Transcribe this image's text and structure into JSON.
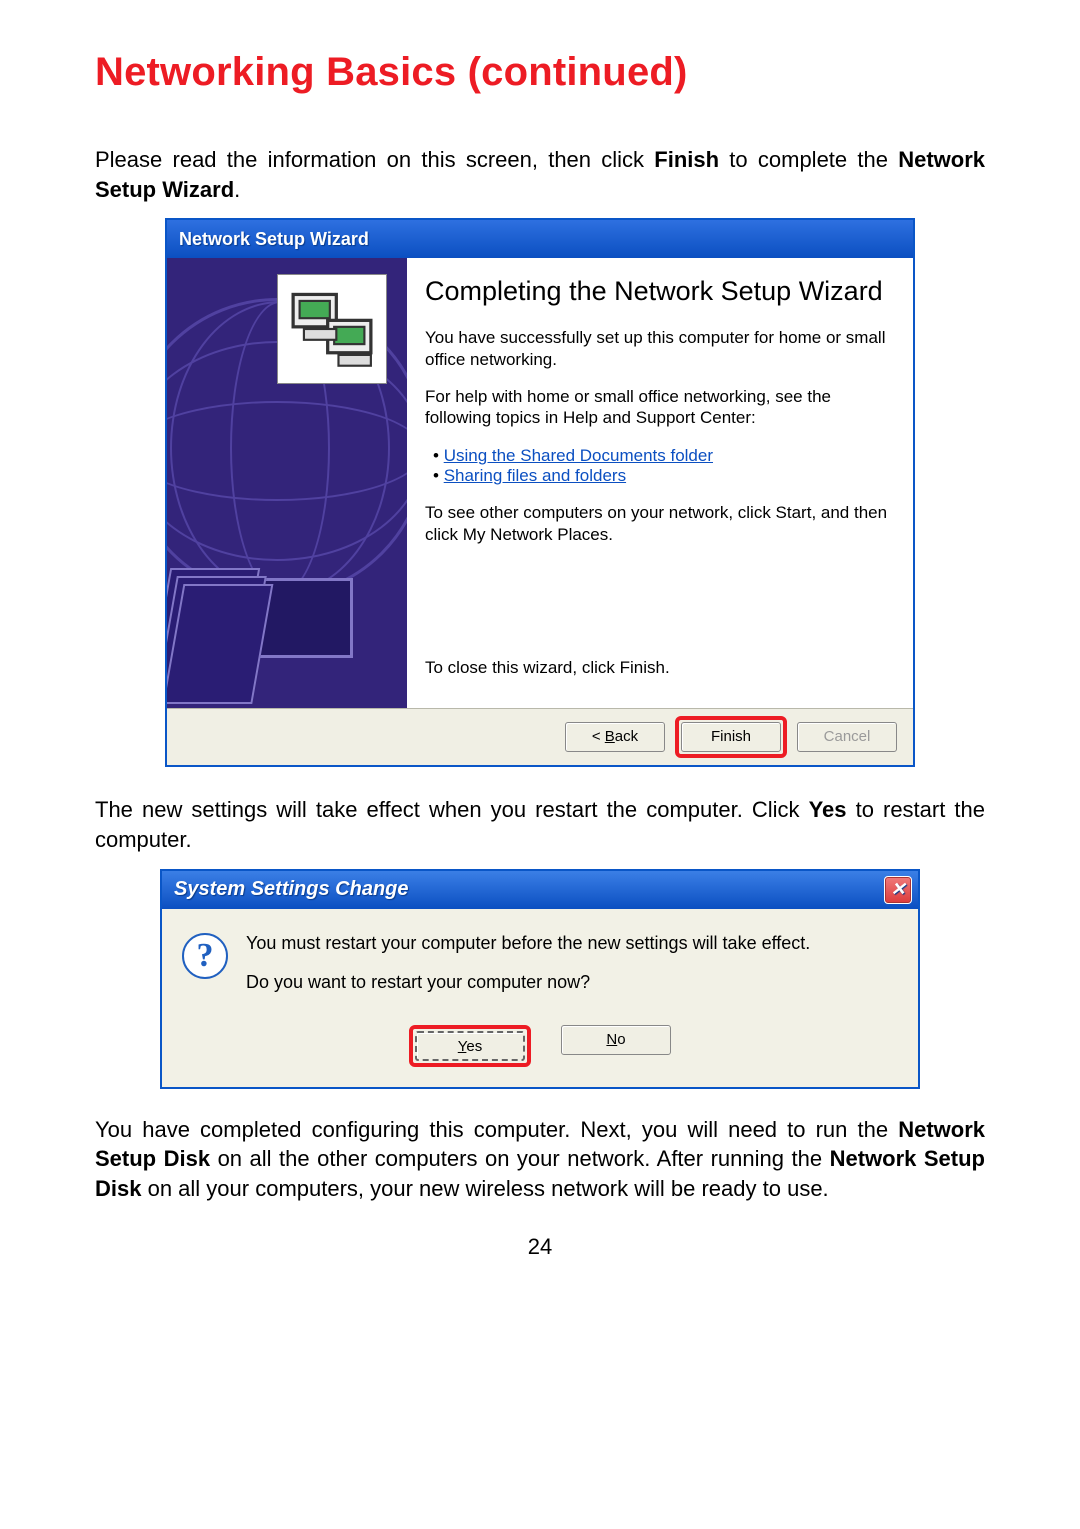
{
  "heading": "Networking Basics (continued)",
  "intro_html": "Please read the information on this screen, then click <b>Finish</b> to complete the <b>Network Setup  Wizard</b>.",
  "wizard": {
    "title": "Network Setup Wizard",
    "content_title": "Completing the Network Setup Wizard",
    "para1": "You have successfully set up this computer for home or small office networking.",
    "para2": "For help with home or small office networking, see the following topics in Help and Support Center:",
    "links": [
      "Using the Shared Documents folder",
      "Sharing files and folders"
    ],
    "para3": "To see other computers on your network, click Start, and then click My Network Places.",
    "para4": "To close this wizard, click Finish.",
    "buttons": {
      "back_prefix": "< ",
      "back_ul": "B",
      "back_rest": "ack",
      "finish": "Finish",
      "cancel": "Cancel"
    }
  },
  "mid_text_html": "The new settings will take effect when you restart the computer. Click <b>Yes</b> to restart the computer.",
  "dialog2": {
    "title": "System Settings Change",
    "line1": "You must restart your computer before the new settings will take effect.",
    "line2": "Do you want to restart your computer now?",
    "yes_ul": "Y",
    "yes_rest": "es",
    "no_ul": "N",
    "no_rest": "o"
  },
  "outro_html": "You have completed configuring this computer. Next, you will need to run the <b>Network Setup Disk</b> on all the other computers on your network.  After running the <b>Network Setup Disk</b> on all your computers, your new wireless network will be ready to use.",
  "page_number": "24"
}
